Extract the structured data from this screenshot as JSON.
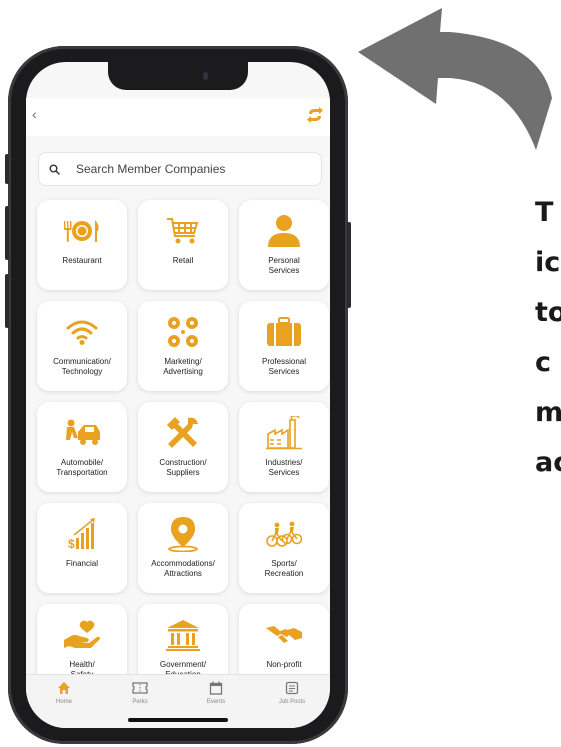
{
  "caption": {
    "lines": [
      "T",
      "ic",
      "to",
      "c",
      "m",
      "ac"
    ]
  },
  "colors": {
    "accent": "#E8A21F",
    "arrow": "#707070",
    "tab_active": "#E8A21F",
    "tab_inactive": "#888888"
  },
  "search": {
    "placeholder": "Search Member Companies"
  },
  "categories": [
    {
      "label": "Restaurant",
      "icon": "restaurant-icon"
    },
    {
      "label": "Retail",
      "icon": "shopping-cart-icon"
    },
    {
      "label": "Personal\nServices",
      "icon": "person-icon"
    },
    {
      "label": "Communication/\nTechnology",
      "icon": "wifi-icon"
    },
    {
      "label": "Marketing/\nAdvertising",
      "icon": "network-icon"
    },
    {
      "label": "Professional\nServices",
      "icon": "briefcase-icon"
    },
    {
      "label": "Automobile/\nTransportation",
      "icon": "car-repair-icon"
    },
    {
      "label": "Construction/\nSuppliers",
      "icon": "tools-icon"
    },
    {
      "label": "Industries/\nServices",
      "icon": "factory-icon"
    },
    {
      "label": "Financial",
      "icon": "finance-chart-icon"
    },
    {
      "label": "Accommodations/\nAttractions",
      "icon": "location-pin-icon"
    },
    {
      "label": "Sports/\nRecreation",
      "icon": "cyclists-icon"
    },
    {
      "label": "Health/\nSafety",
      "icon": "heart-hand-icon"
    },
    {
      "label": "Government/\nEducation",
      "icon": "bank-building-icon"
    },
    {
      "label": "Non-profit",
      "icon": "handshake-icon"
    }
  ],
  "tabs": [
    {
      "label": "Home",
      "icon": "home-icon",
      "active": true
    },
    {
      "label": "Perks",
      "icon": "ticket-icon",
      "active": false
    },
    {
      "label": "Events",
      "icon": "calendar-icon",
      "active": false
    },
    {
      "label": "Job Posts",
      "icon": "job-card-icon",
      "active": false
    }
  ]
}
